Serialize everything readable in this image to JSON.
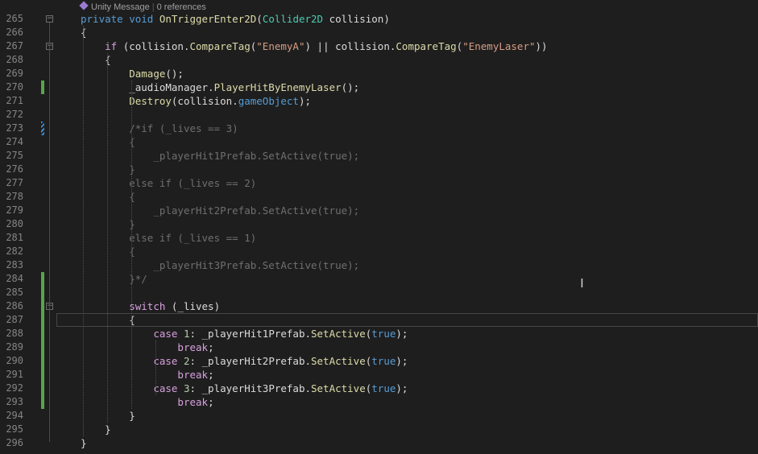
{
  "codelens": {
    "unity_message": "Unity Message",
    "references": "0 references",
    "separator": "|"
  },
  "lines": [
    {
      "n": "265",
      "indent": "",
      "seg": [
        [
          "kw",
          "private"
        ],
        [
          "",
          " "
        ],
        [
          "kw",
          "void"
        ],
        [
          "",
          " "
        ],
        [
          "mt",
          "OnTriggerEnter2D"
        ],
        [
          "",
          "("
        ],
        [
          "ty",
          "Collider2D"
        ],
        [
          "",
          " collision)"
        ]
      ]
    },
    {
      "n": "266",
      "indent": "",
      "seg": [
        [
          "",
          "{"
        ]
      ]
    },
    {
      "n": "267",
      "indent": "    ",
      "seg": [
        [
          "kw2",
          "if"
        ],
        [
          "",
          " (collision."
        ],
        [
          "mt",
          "CompareTag"
        ],
        [
          "",
          "("
        ],
        [
          "st",
          "\"EnemyA\""
        ],
        [
          "",
          ") || collision."
        ],
        [
          "mt",
          "CompareTag"
        ],
        [
          "",
          "("
        ],
        [
          "st",
          "\"EnemyLaser\""
        ],
        [
          "",
          "))"
        ]
      ]
    },
    {
      "n": "268",
      "indent": "    ",
      "seg": [
        [
          "",
          "{"
        ]
      ]
    },
    {
      "n": "269",
      "indent": "        ",
      "seg": [
        [
          "mt",
          "Damage"
        ],
        [
          "",
          "();"
        ]
      ]
    },
    {
      "n": "270",
      "indent": "        ",
      "seg": [
        [
          "",
          "_audioManager."
        ],
        [
          "mt",
          "PlayerHitByEnemyLaser"
        ],
        [
          "",
          "();"
        ]
      ]
    },
    {
      "n": "271",
      "indent": "        ",
      "seg": [
        [
          "mt",
          "Destroy"
        ],
        [
          "",
          "(collision."
        ],
        [
          "kw",
          "gameObject"
        ],
        [
          "",
          ");"
        ]
      ]
    },
    {
      "n": "272",
      "indent": "",
      "seg": []
    },
    {
      "n": "273",
      "indent": "        ",
      "seg": [
        [
          "cm",
          "/*if (_lives == 3)"
        ]
      ]
    },
    {
      "n": "274",
      "indent": "        ",
      "seg": [
        [
          "cm",
          "{"
        ]
      ]
    },
    {
      "n": "275",
      "indent": "            ",
      "seg": [
        [
          "cm",
          "_playerHit1Prefab.SetActive(true);"
        ]
      ]
    },
    {
      "n": "276",
      "indent": "        ",
      "seg": [
        [
          "cm",
          "}"
        ]
      ]
    },
    {
      "n": "277",
      "indent": "        ",
      "seg": [
        [
          "cm",
          "else if (_lives == 2)"
        ]
      ]
    },
    {
      "n": "278",
      "indent": "        ",
      "seg": [
        [
          "cm",
          "{"
        ]
      ]
    },
    {
      "n": "279",
      "indent": "            ",
      "seg": [
        [
          "cm",
          "_playerHit2Prefab.SetActive(true);"
        ]
      ]
    },
    {
      "n": "280",
      "indent": "        ",
      "seg": [
        [
          "cm",
          "}"
        ]
      ]
    },
    {
      "n": "281",
      "indent": "        ",
      "seg": [
        [
          "cm",
          "else if (_lives == 1)"
        ]
      ]
    },
    {
      "n": "282",
      "indent": "        ",
      "seg": [
        [
          "cm",
          "{"
        ]
      ]
    },
    {
      "n": "283",
      "indent": "            ",
      "seg": [
        [
          "cm",
          "_playerHit3Prefab.SetActive(true);"
        ]
      ]
    },
    {
      "n": "284",
      "indent": "        ",
      "seg": [
        [
          "cm",
          "}*/"
        ]
      ]
    },
    {
      "n": "285",
      "indent": "",
      "seg": []
    },
    {
      "n": "286",
      "indent": "        ",
      "seg": [
        [
          "kw2",
          "switch"
        ],
        [
          "",
          " (_lives)"
        ]
      ]
    },
    {
      "n": "287",
      "indent": "        ",
      "seg": [
        [
          "",
          "{"
        ]
      ]
    },
    {
      "n": "288",
      "indent": "            ",
      "seg": [
        [
          "kw2",
          "case"
        ],
        [
          "",
          " "
        ],
        [
          "nm",
          "1"
        ],
        [
          "",
          ": _playerHit1Prefab."
        ],
        [
          "mt",
          "SetActive"
        ],
        [
          "",
          "("
        ],
        [
          "kw",
          "true"
        ],
        [
          "",
          ");"
        ]
      ]
    },
    {
      "n": "289",
      "indent": "                ",
      "seg": [
        [
          "kw2",
          "break"
        ],
        [
          "",
          ";"
        ]
      ]
    },
    {
      "n": "290",
      "indent": "            ",
      "seg": [
        [
          "kw2",
          "case"
        ],
        [
          "",
          " "
        ],
        [
          "nm",
          "2"
        ],
        [
          "",
          ": _playerHit2Prefab."
        ],
        [
          "mt",
          "SetActive"
        ],
        [
          "",
          "("
        ],
        [
          "kw",
          "true"
        ],
        [
          "",
          ");"
        ]
      ]
    },
    {
      "n": "291",
      "indent": "                ",
      "seg": [
        [
          "kw2",
          "break"
        ],
        [
          "",
          ";"
        ]
      ]
    },
    {
      "n": "292",
      "indent": "            ",
      "seg": [
        [
          "kw2",
          "case"
        ],
        [
          "",
          " "
        ],
        [
          "nm",
          "3"
        ],
        [
          "",
          ": _playerHit3Prefab."
        ],
        [
          "mt",
          "SetActive"
        ],
        [
          "",
          "("
        ],
        [
          "kw",
          "true"
        ],
        [
          "",
          ");"
        ]
      ]
    },
    {
      "n": "293",
      "indent": "                ",
      "seg": [
        [
          "kw2",
          "break"
        ],
        [
          "",
          ";"
        ]
      ]
    },
    {
      "n": "294",
      "indent": "        ",
      "seg": [
        [
          "",
          "}"
        ]
      ]
    },
    {
      "n": "295",
      "indent": "    ",
      "seg": [
        [
          "",
          "}"
        ]
      ]
    },
    {
      "n": "296",
      "indent": "",
      "seg": [
        [
          "",
          "}"
        ]
      ]
    }
  ],
  "change_markers": {
    "saved": [
      "270",
      "284",
      "285",
      "286",
      "287",
      "288",
      "289",
      "290",
      "291",
      "292",
      "293"
    ],
    "edited": [
      "273"
    ]
  },
  "fold_markers": {
    "collapsible": [
      "265",
      "267",
      "286"
    ],
    "glyph": "−"
  },
  "current_line": "287",
  "cursor_glyph": "I",
  "colors": {
    "background": "#1e1e1e",
    "line_number": "#858585",
    "keyword": "#569cd6",
    "control_keyword": "#d8a0df",
    "type": "#4ec9b0",
    "method": "#dcdcaa",
    "string": "#d69d85",
    "number": "#b5cea8",
    "comment": "#6f6f6f",
    "saved_change": "#57a64a",
    "edited_change": "#3a8fd6"
  }
}
